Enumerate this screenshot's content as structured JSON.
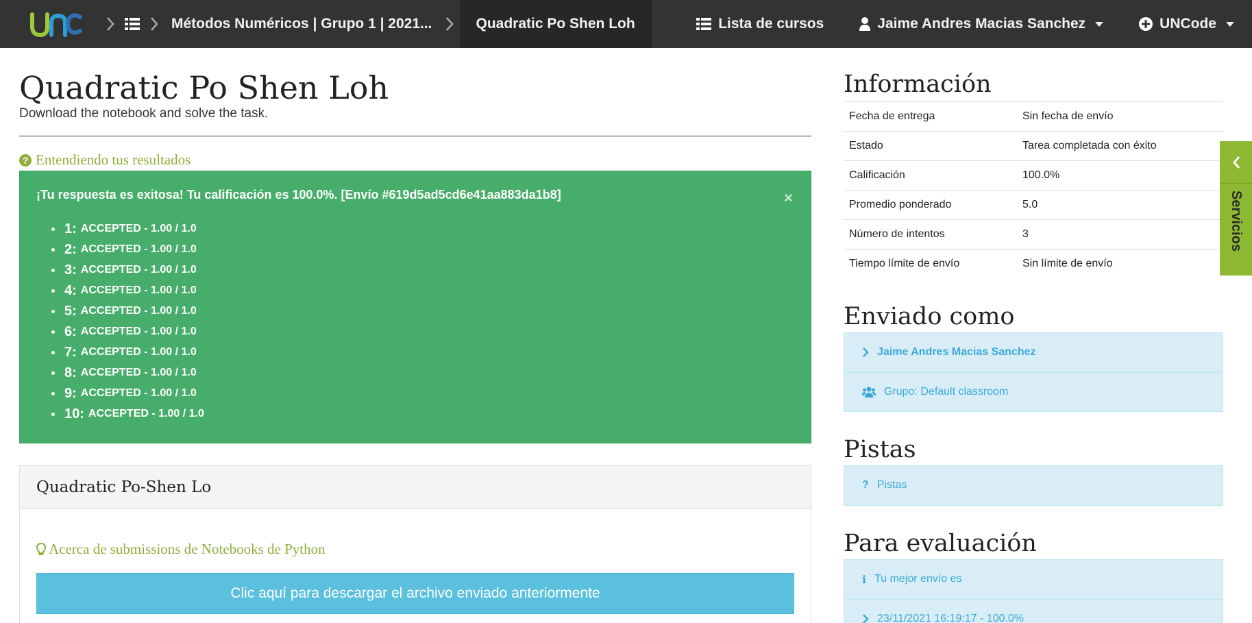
{
  "navbar": {
    "breadcrumbs": [
      {
        "label": "Métodos Numéricos | Grupo 1 | 2021..."
      },
      {
        "label": "Quadratic Po Shen Loh"
      }
    ],
    "courses_label": "Lista de cursos",
    "user_label": "Jaime Andres Macias Sanchez",
    "brand_label": "UNCode"
  },
  "task": {
    "title": "Quadratic Po Shen Loh",
    "subtitle": "Download the notebook and solve the task.",
    "results_link": "Entendiendo tus resultados"
  },
  "alert": {
    "message": "¡Tu respuesta es exitosa! Tu calificación es 100.0%. [Envío #619d5ad5cd6e41aa883da1b8]",
    "close": "×",
    "results": [
      {
        "num": "1:",
        "text": "ACCEPTED - 1.00 / 1.0"
      },
      {
        "num": "2:",
        "text": "ACCEPTED - 1.00 / 1.0"
      },
      {
        "num": "3:",
        "text": "ACCEPTED - 1.00 / 1.0"
      },
      {
        "num": "4:",
        "text": "ACCEPTED - 1.00 / 1.0"
      },
      {
        "num": "5:",
        "text": "ACCEPTED - 1.00 / 1.0"
      },
      {
        "num": "6:",
        "text": "ACCEPTED - 1.00 / 1.0"
      },
      {
        "num": "7:",
        "text": "ACCEPTED - 1.00 / 1.0"
      },
      {
        "num": "8:",
        "text": "ACCEPTED - 1.00 / 1.0"
      },
      {
        "num": "9:",
        "text": "ACCEPTED - 1.00 / 1.0"
      },
      {
        "num": "10:",
        "text": "ACCEPTED - 1.00 / 1.0"
      }
    ]
  },
  "problem": {
    "heading": "Quadratic Po-Shen Lo",
    "about_link": "Acerca de submissions de Notebooks de Python",
    "download_button": "Clic aquí para descargar el archivo enviado anteriormente"
  },
  "sidebar": {
    "info_title": "Información",
    "info_rows": [
      {
        "key": "Fecha de entrega",
        "value": "Sin fecha de envío"
      },
      {
        "key": "Estado",
        "value": "Tarea completada con éxito"
      },
      {
        "key": "Calificación",
        "value": "100.0%"
      },
      {
        "key": "Promedio ponderado",
        "value": "5.0"
      },
      {
        "key": "Número de intentos",
        "value": "3"
      },
      {
        "key": "Tiempo límite de envío",
        "value": "Sin límite de envío"
      }
    ],
    "sent_as_title": "Enviado como",
    "sent_as_user": "Jaime Andres Macias Sanchez",
    "sent_as_group": "Grupo: Default classroom",
    "hints_title": "Pistas",
    "hints_item": "Pistas",
    "eval_title": "Para evaluación",
    "eval_best": "Tu mejor envío es",
    "eval_submission": "23/11/2021 16:19:17 - 100.0%"
  },
  "services_tab": {
    "label": "Servicios"
  },
  "colors": {
    "navbar": "#333333",
    "success": "#46ae6a",
    "accent_green": "#8fae3b",
    "info_bg": "#d9edf7",
    "info_text": "#3ba9d9",
    "button": "#5bc0de"
  }
}
